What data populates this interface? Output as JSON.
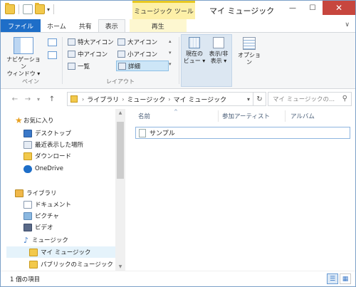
{
  "window": {
    "title": "マイ ミュージック",
    "context_group": "ミュージック ツール",
    "controls": {
      "minimize": "—",
      "maximize": "☐",
      "close": "✕"
    }
  },
  "quick_access": {
    "dropdown_arrow": "▾"
  },
  "tabs": [
    {
      "label": "ファイル"
    },
    {
      "label": "ホーム"
    },
    {
      "label": "共有"
    },
    {
      "label": "表示"
    },
    {
      "label": "再生"
    }
  ],
  "ribbon_collapse": "∨",
  "ribbon": {
    "pane_group": {
      "label": "ペイン",
      "nav_pane_button": "ナビゲーション\nウィンドウ ▾"
    },
    "layout_group": {
      "label": "レイアウト",
      "options": [
        {
          "label": "特大アイコン"
        },
        {
          "label": "大アイコン"
        },
        {
          "label": "中アイコン"
        },
        {
          "label": "小アイコン"
        },
        {
          "label": "一覧"
        },
        {
          "label": "詳細"
        }
      ]
    },
    "view_buttons": {
      "current_view": "現在の\nビュー ▾",
      "show_hide": "表示/非\n表示 ▾",
      "options": "オプション"
    }
  },
  "address": {
    "back": "←",
    "forward": "→",
    "recent": "▾",
    "up": "↑",
    "breadcrumbs": [
      "ライブラリ",
      "ミュージック",
      "マイ ミュージック"
    ],
    "separator": "›",
    "dropdown": "▾",
    "refresh": "↻",
    "search_placeholder": "マイ ミュージックの...",
    "search_icon": "⚲"
  },
  "nav_pane": {
    "favorites_header": "お気に入り",
    "favorites": [
      {
        "label": "デスクトップ"
      },
      {
        "label": "最近表示した場所"
      },
      {
        "label": "ダウンロード"
      }
    ],
    "onedrive": "OneDrive",
    "libraries_header": "ライブラリ",
    "libraries": [
      {
        "label": "ドキュメント"
      },
      {
        "label": "ピクチャ"
      },
      {
        "label": "ビデオ"
      },
      {
        "label": "ミュージック"
      }
    ],
    "music_children": [
      {
        "label": "マイ ミュージック",
        "selected": true
      },
      {
        "label": "パブリックのミュージック"
      }
    ]
  },
  "columns": {
    "name": "名前",
    "sort_arrow": "^",
    "artist": "参加アーティスト",
    "album": "アルバム"
  },
  "files": [
    {
      "name": "サンプル"
    }
  ],
  "status": {
    "count": "1 個の項目"
  }
}
